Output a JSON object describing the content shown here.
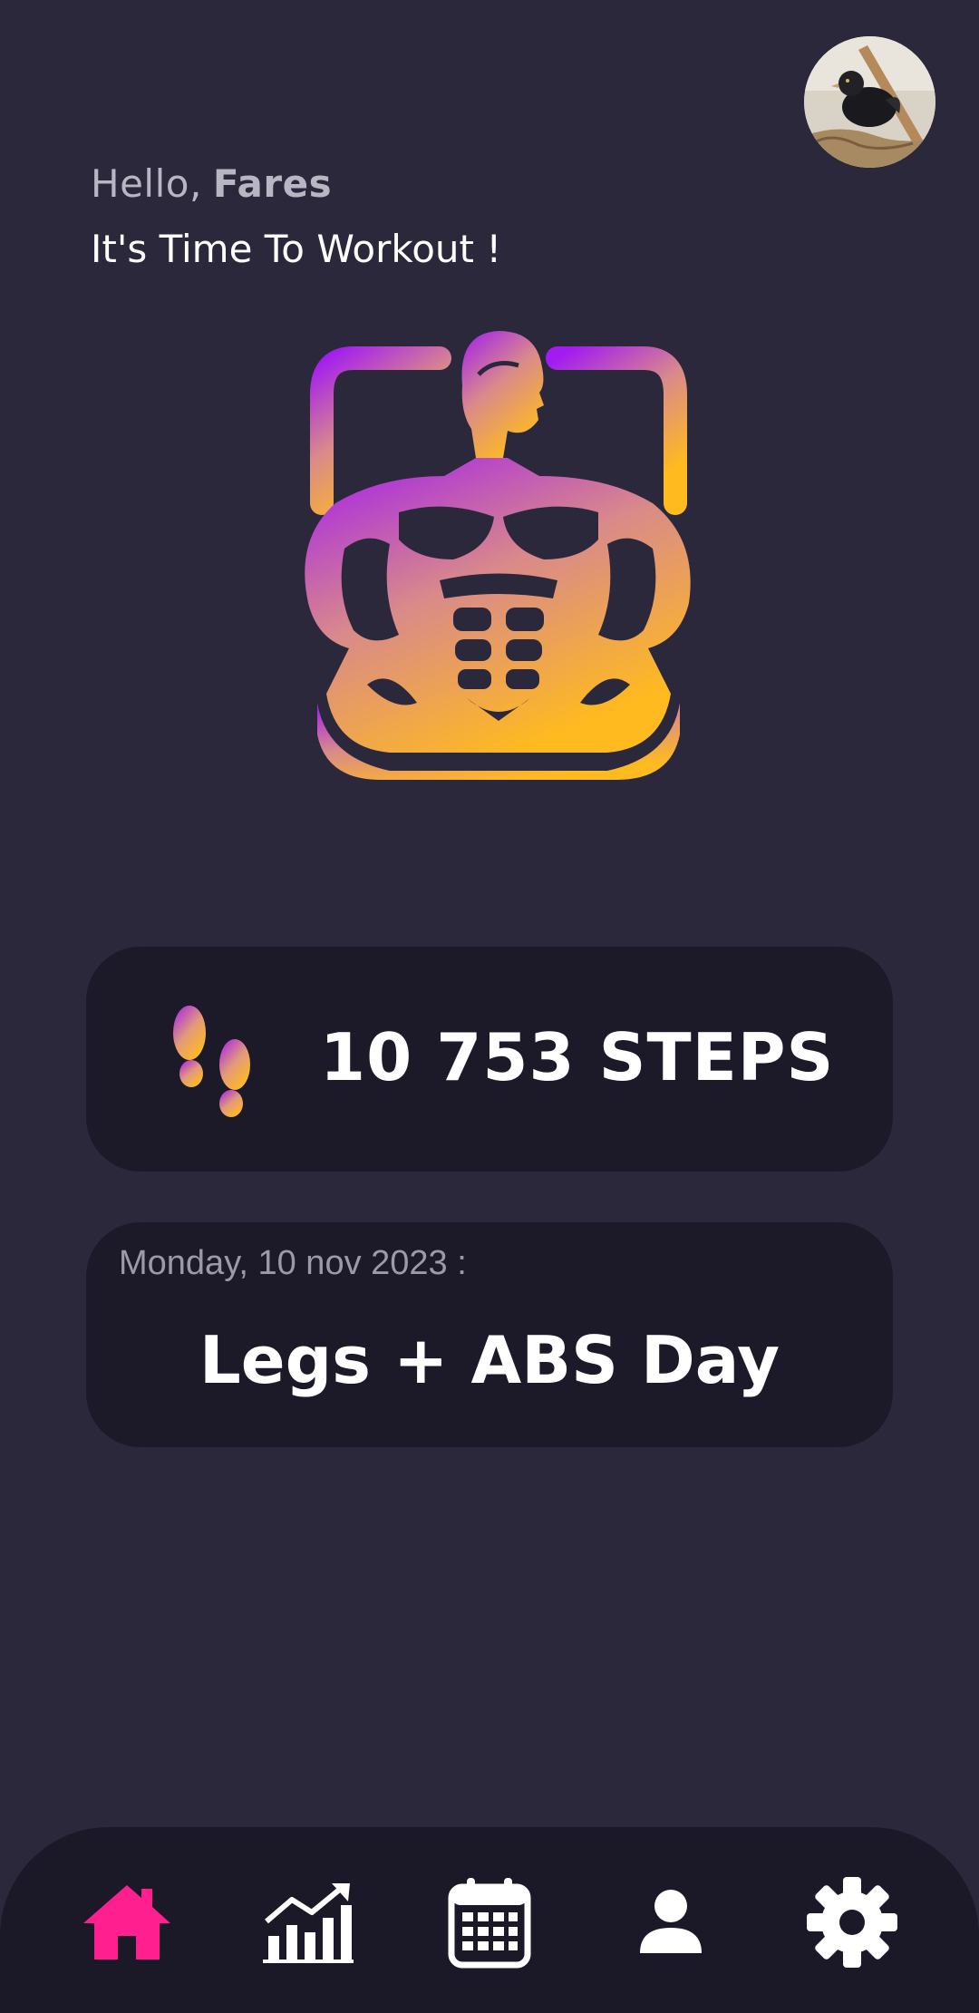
{
  "header": {
    "hello": "Hello,",
    "user_name": "Fares",
    "subtitle": "It's Time To Workout !"
  },
  "avatar": {
    "icon": "user-avatar-photo"
  },
  "logo": {
    "icon": "muscular-man-logo",
    "gradient_start": "#a21cf0",
    "gradient_end": "#ffba20"
  },
  "steps_card": {
    "icon": "footsteps-icon",
    "text": "10 753 STEPS"
  },
  "workout_card": {
    "date": "Monday, 10 nov 2023 :",
    "title": "Legs + ABS Day"
  },
  "bottom_nav": {
    "items": [
      {
        "icon": "home-icon",
        "active": true
      },
      {
        "icon": "stats-chart-icon",
        "active": false
      },
      {
        "icon": "calendar-icon",
        "active": false
      },
      {
        "icon": "profile-icon",
        "active": false
      },
      {
        "icon": "settings-gear-icon",
        "active": false
      }
    ],
    "active_color": "#ff1f8e",
    "inactive_color": "#ffffff"
  },
  "colors": {
    "background": "#2b283c",
    "card": "#1c1a28",
    "nav": "#1b1927"
  }
}
